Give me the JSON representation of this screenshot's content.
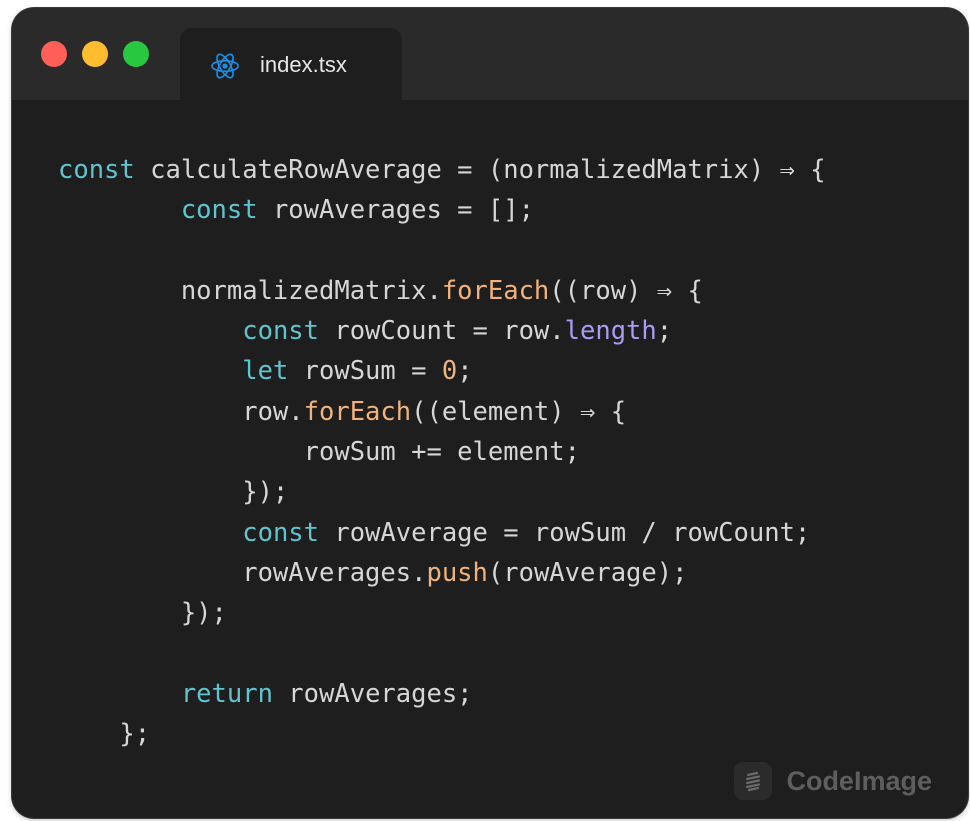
{
  "tab": {
    "icon": "react-icon",
    "filename": "index.tsx"
  },
  "window_controls": [
    "close-dot",
    "minimize-dot",
    "zoom-dot"
  ],
  "code_lines": [
    [
      {
        "t": "const",
        "c": "k"
      },
      {
        "t": " calculateRowAverage = (normalizedMatrix) ⇒ {"
      }
    ],
    [
      {
        "t": "        "
      },
      {
        "t": "const",
        "c": "k"
      },
      {
        "t": " rowAverages = [];"
      }
    ],
    [
      {
        "t": ""
      }
    ],
    [
      {
        "t": "        normalizedMatrix."
      },
      {
        "t": "forEach",
        "c": "f"
      },
      {
        "t": "((row) ⇒ {"
      }
    ],
    [
      {
        "t": "            "
      },
      {
        "t": "const",
        "c": "k"
      },
      {
        "t": " rowCount = row."
      },
      {
        "t": "length",
        "c": "p"
      },
      {
        "t": ";"
      }
    ],
    [
      {
        "t": "            "
      },
      {
        "t": "let",
        "c": "k"
      },
      {
        "t": " rowSum = "
      },
      {
        "t": "0",
        "c": "n"
      },
      {
        "t": ";"
      }
    ],
    [
      {
        "t": "            row."
      },
      {
        "t": "forEach",
        "c": "f"
      },
      {
        "t": "((element) ⇒ {"
      }
    ],
    [
      {
        "t": "                rowSum += element;"
      }
    ],
    [
      {
        "t": "            });"
      }
    ],
    [
      {
        "t": "            "
      },
      {
        "t": "const",
        "c": "k"
      },
      {
        "t": " rowAverage = rowSum / rowCount;"
      }
    ],
    [
      {
        "t": "            rowAverages."
      },
      {
        "t": "push",
        "c": "f"
      },
      {
        "t": "(rowAverage);"
      }
    ],
    [
      {
        "t": "        });"
      }
    ],
    [
      {
        "t": ""
      }
    ],
    [
      {
        "t": "        "
      },
      {
        "t": "return",
        "c": "k"
      },
      {
        "t": " rowAverages;"
      }
    ],
    [
      {
        "t": "    };"
      }
    ]
  ],
  "watermark": {
    "icon": "codeimage-logo-icon",
    "text": "CodeImage"
  },
  "colors": {
    "background": "#1e1e1f",
    "titlebar": "#2a2a2b",
    "keyword": "#5ec4cf",
    "function": "#f2b27a",
    "property": "#a99bf5",
    "number": "#f2b27a",
    "text": "#d6d6d6"
  }
}
